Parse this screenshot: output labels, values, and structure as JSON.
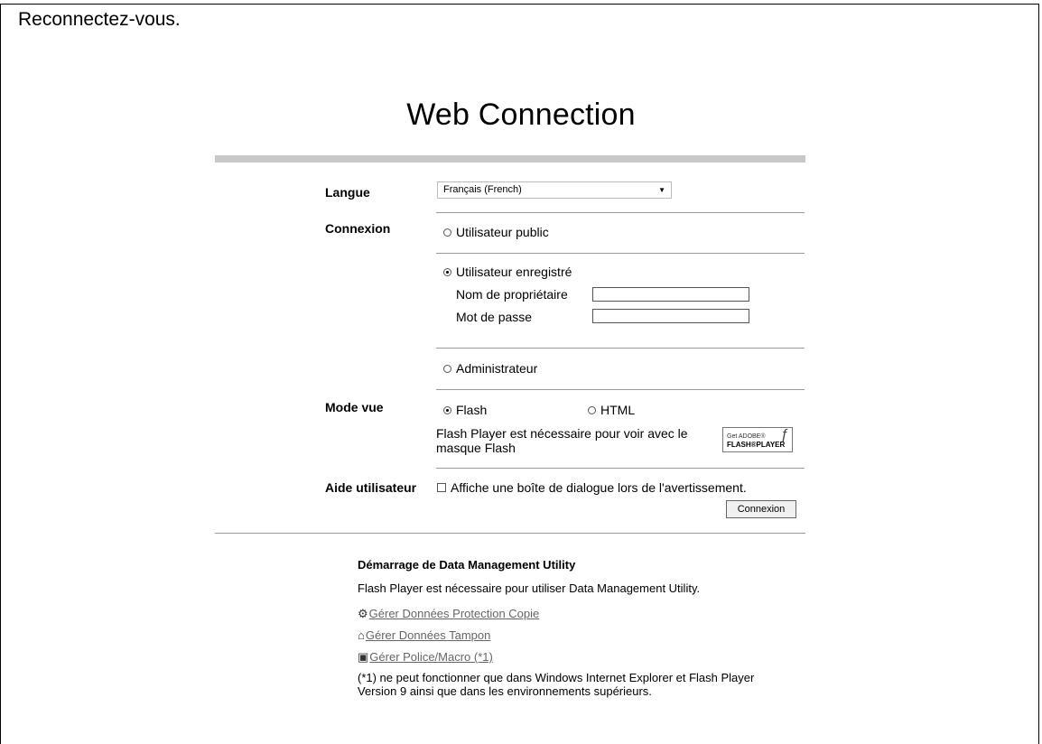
{
  "hint": "Reconnectez-vous.",
  "title": "Web Connection",
  "labels": {
    "language": "Langue",
    "connection": "Connexion",
    "view_mode": "Mode vue",
    "user_help": "Aide utilisateur"
  },
  "language_select": {
    "value": "Français (French)"
  },
  "connection": {
    "public_user": "Utilisateur public",
    "registered_user": "Utilisateur enregistré",
    "owner_name_label": "Nom de propriétaire",
    "password_label": "Mot de passe",
    "owner_name_value": "",
    "password_value": "",
    "administrator": "Administrateur",
    "selected": "registered_user"
  },
  "view_mode": {
    "flash": "Flash",
    "html": "HTML",
    "selected": "flash",
    "flash_note_line1": "Flash Player est nécessaire pour voir avec le",
    "flash_note_line2": "masque Flash",
    "flash_logo_top": "Get ADOBE®",
    "flash_logo_bottom": "FLASH®PLAYER"
  },
  "user_help": {
    "checkbox_label": "Affiche une boîte de dialogue lors de l'avertissement.",
    "checked": false
  },
  "login_button": "Connexion",
  "dmu": {
    "heading": "Démarrage de Data Management Utility",
    "note": "Flash Player est nécessaire pour utiliser Data Management Utility.",
    "links": [
      {
        "label": "Gérer Données Protection Copie",
        "icon": "copy-protection-icon"
      },
      {
        "label": "Gérer Données Tampon",
        "icon": "stamp-icon"
      },
      {
        "label": "Gérer Police/Macro (*1)",
        "icon": "font-macro-icon"
      }
    ],
    "footnote_line1": "(*1) ne peut fonctionner que dans Windows Internet Explorer et Flash Player",
    "footnote_line2": "Version 9 ainsi que dans les environnements supérieurs."
  }
}
